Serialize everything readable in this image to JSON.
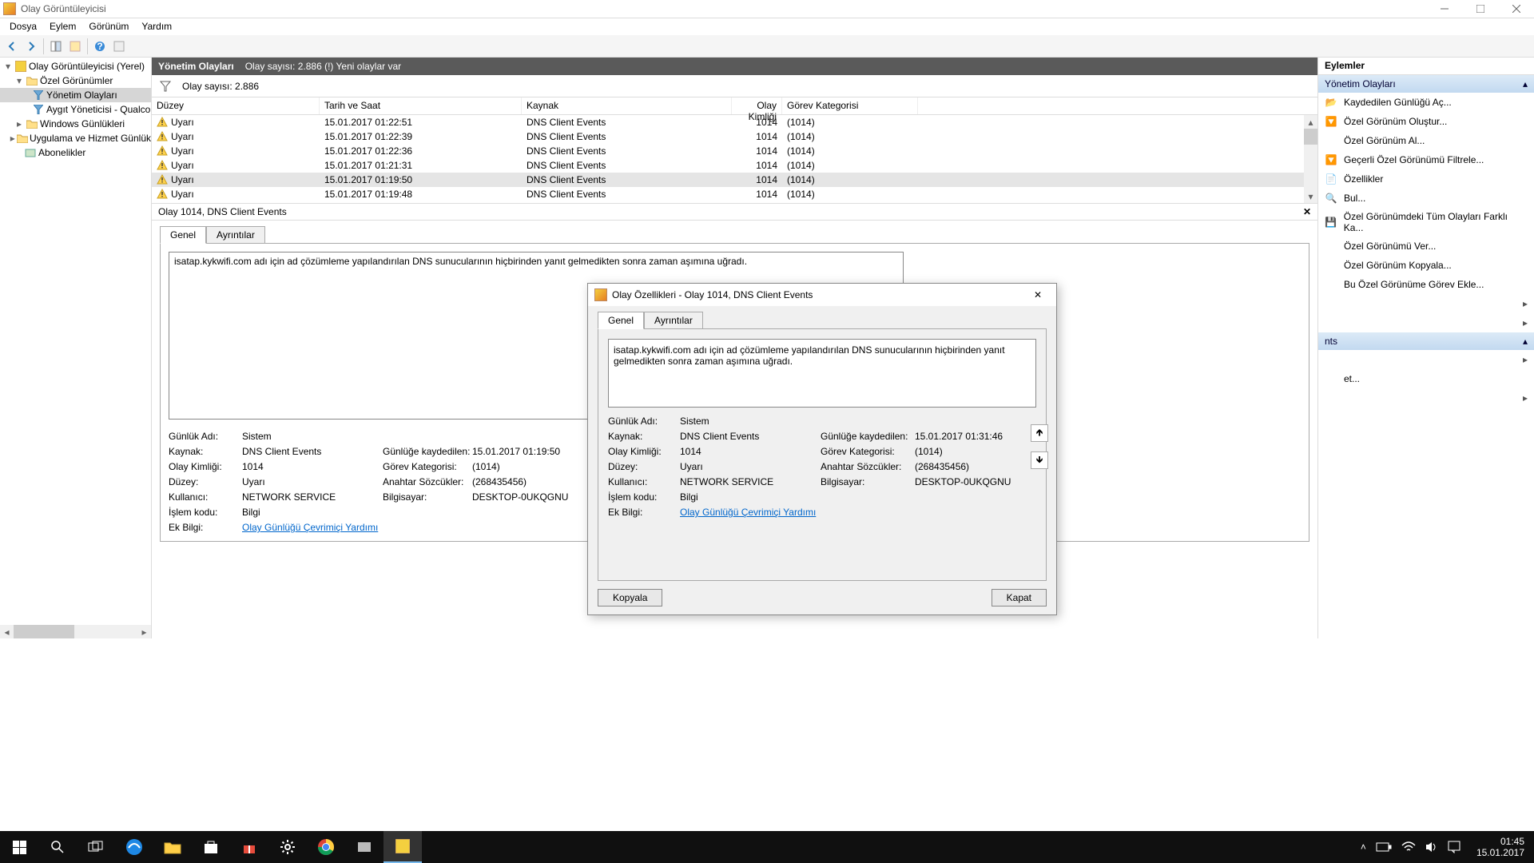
{
  "window": {
    "title": "Olay Görüntüleyicisi"
  },
  "menu": [
    "Dosya",
    "Eylem",
    "Görünüm",
    "Yardım"
  ],
  "tree": {
    "root": "Olay Görüntüleyicisi (Yerel)",
    "custom": "Özel Görünümler",
    "admin": "Yönetim Olayları",
    "qualco": "Aygıt Yöneticisi - Qualco",
    "winlogs": "Windows Günlükleri",
    "appsvc": "Uygulama ve Hizmet Günlük",
    "subs": "Abonelikler"
  },
  "subheader": {
    "title": "Yönetim Olayları",
    "count_long": "Olay sayısı: 2.886 (!) Yeni olaylar var",
    "count_short": "Olay sayısı: 2.886"
  },
  "columns": {
    "level": "Düzey",
    "date": "Tarih ve Saat",
    "source": "Kaynak",
    "id": "Olay Kimliği",
    "task": "Görev Kategorisi"
  },
  "rows": [
    {
      "level": "Uyarı",
      "date": "15.01.2017 01:22:51",
      "source": "DNS Client Events",
      "id": "1014",
      "task": "(1014)"
    },
    {
      "level": "Uyarı",
      "date": "15.01.2017 01:22:39",
      "source": "DNS Client Events",
      "id": "1014",
      "task": "(1014)"
    },
    {
      "level": "Uyarı",
      "date": "15.01.2017 01:22:36",
      "source": "DNS Client Events",
      "id": "1014",
      "task": "(1014)"
    },
    {
      "level": "Uyarı",
      "date": "15.01.2017 01:21:31",
      "source": "DNS Client Events",
      "id": "1014",
      "task": "(1014)"
    },
    {
      "level": "Uyarı",
      "date": "15.01.2017 01:19:50",
      "source": "DNS Client Events",
      "id": "1014",
      "task": "(1014)",
      "sel": true
    },
    {
      "level": "Uyarı",
      "date": "15.01.2017 01:19:48",
      "source": "DNS Client Events",
      "id": "1014",
      "task": "(1014)"
    }
  ],
  "detail": {
    "header": "Olay 1014, DNS Client Events",
    "tabs": {
      "general": "Genel",
      "details": "Ayrıntılar"
    },
    "message": "isatap.kykwifi.com adı için ad çözümleme yapılandırılan DNS sunucularının hiçbirinden yanıt gelmedikten sonra zaman aşımına uğradı.",
    "labels": {
      "logname": "Günlük Adı:",
      "source": "Kaynak:",
      "eventid": "Olay Kimliği:",
      "level": "Düzey:",
      "user": "Kullanıcı:",
      "opcode": "İşlem kodu:",
      "more": "Ek Bilgi:",
      "logged": "Günlüğe kaydedilen:",
      "task": "Görev Kategorisi:",
      "keywords": "Anahtar Sözcükler:",
      "computer": "Bilgisayar:"
    },
    "values": {
      "logname": "Sistem",
      "source": "DNS Client Events",
      "eventid": "1014",
      "level": "Uyarı",
      "user": "NETWORK SERVICE",
      "opcode": "Bilgi",
      "logged": "15.01.2017 01:19:50",
      "task": "(1014)",
      "keywords": "(268435456)",
      "computer": "DESKTOP-0UKQGNU",
      "morelink": "Olay Günlüğü Çevrimiçi Yardımı"
    }
  },
  "dialog": {
    "title": "Olay Özellikleri - Olay 1014, DNS Client Events",
    "message": "isatap.kykwifi.com adı için ad çözümleme yapılandırılan DNS sunucularının hiçbirinden yanıt gelmedikten sonra zaman aşımına uğradı.",
    "values": {
      "logname": "Sistem",
      "source": "DNS Client Events",
      "eventid": "1014",
      "level": "Uyarı",
      "user": "NETWORK SERVICE",
      "opcode": "Bilgi",
      "logged": "15.01.2017 01:31:46",
      "task": "(1014)",
      "keywords": "(268435456)",
      "computer": "DESKTOP-0UKQGNU",
      "morelink": "Olay Günlüğü Çevrimiçi Yardımı"
    },
    "copy": "Kopyala",
    "close": "Kapat"
  },
  "actions": {
    "header": "Eylemler",
    "group1": "Yönetim Olayları",
    "items1": [
      "Kaydedilen Günlüğü Aç...",
      "Özel Görünüm Oluştur...",
      "Özel Görünüm Al...",
      "Geçerli Özel Görünümü Filtrele...",
      "Özellikler",
      "Bul...",
      "Özel Görünümdeki Tüm Olayları Farklı Ka...",
      "Özel Görünümü Ver...",
      "Özel Görünüm Kopyala...",
      "Bu Özel Görünüme Görev Ekle..."
    ],
    "group2_tail": "nts",
    "item_tail": "et..."
  },
  "taskbar": {
    "time": "01:45",
    "date": "15.01.2017"
  }
}
